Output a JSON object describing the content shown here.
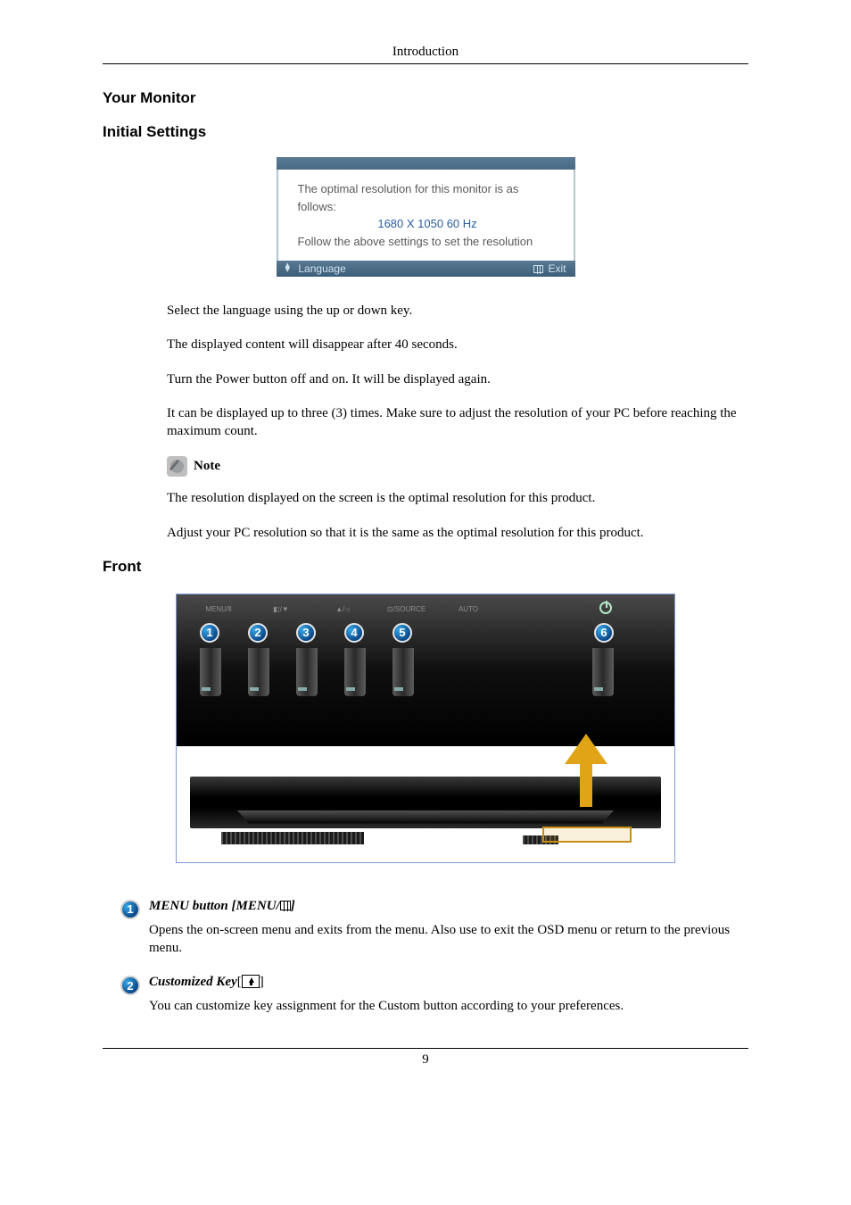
{
  "header": "Introduction",
  "headings": {
    "your_monitor": "Your Monitor",
    "initial_settings": "Initial Settings",
    "front": "Front"
  },
  "osd": {
    "line1": "The optimal resolution for this monitor is as follows:",
    "resolution": "1680 X 1050 60 Hz",
    "line2": "Follow the above settings to set the resolution",
    "language": "Language",
    "exit": "Exit"
  },
  "paras": {
    "p1": "Select the language using the up or down key.",
    "p2": "The displayed content will disappear after 40 seconds.",
    "p3": "Turn the Power button off and on. It will be displayed again.",
    "p4": "It can be displayed up to three (3) times. Make sure to adjust the resolution of your PC before reaching the maximum count.",
    "note_label": "Note",
    "p5": "The resolution displayed on the screen is the optimal resolution for this product.",
    "p6": "Adjust your PC resolution so that it is the same as the optimal resolution for this product."
  },
  "buttons": {
    "lbl1": "MENU/⦀",
    "lbl2": "◧/▼",
    "lbl3": "▲/☼",
    "lbl4": "⊡/SOURCE",
    "lbl5": "AUTO"
  },
  "defs": {
    "d1_title_a": "MENU button [MENU/",
    "d1_title_b": "]",
    "d1_desc": "Opens the on-screen menu and exits from the menu. Also use to exit the OSD menu or return to the previous menu.",
    "d2_title_a": "Customized Key",
    "d2_title_b": "[",
    "d2_title_c": "]",
    "d2_desc": "You can customize key assignment for the Custom button according to your preferences."
  },
  "page_number": "9"
}
